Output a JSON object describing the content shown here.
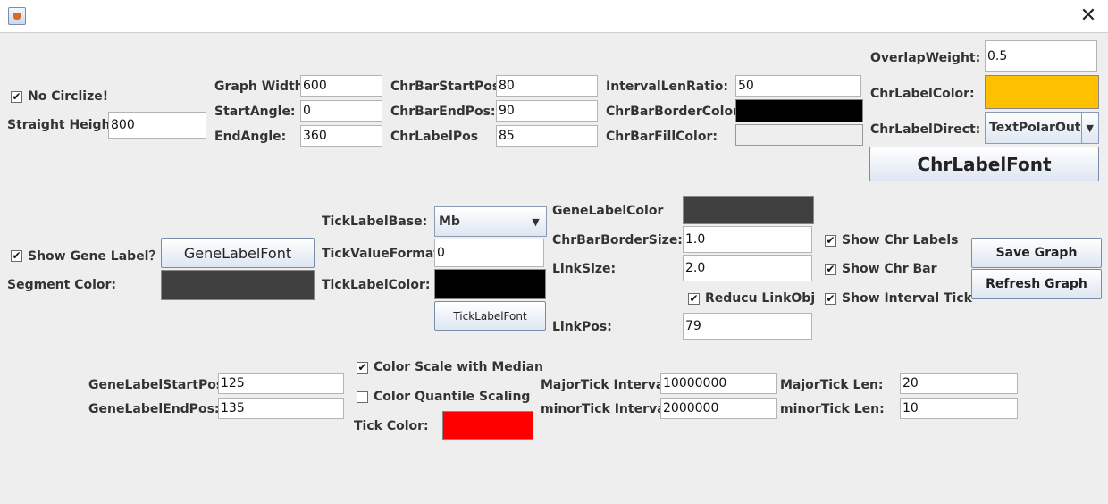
{
  "window": {
    "close_glyph": "✕",
    "app_icon": "java-cup-icon"
  },
  "col1": {
    "no_circlize": {
      "label": "No Circlize!",
      "checked": true
    },
    "straight_height": {
      "label": "Straight Height:",
      "value": "800"
    }
  },
  "col2": {
    "graph_width": {
      "label": "Graph Width:",
      "value": "600"
    },
    "start_angle": {
      "label": "StartAngle:",
      "value": "0"
    },
    "end_angle": {
      "label": "EndAngle:",
      "value": "360"
    }
  },
  "col3": {
    "chr_bar_start_pos": {
      "label": "ChrBarStartPos:",
      "value": "80"
    },
    "chr_bar_end_pos": {
      "label": "ChrBarEndPos:",
      "value": "90"
    },
    "chr_label_pos": {
      "label": "ChrLabelPos",
      "value": "85"
    }
  },
  "col4": {
    "interval_len_ratio": {
      "label": "IntervalLenRatio:",
      "value": "50"
    },
    "chr_bar_border_color": {
      "label": "ChrBarBorderColor:",
      "color": "#000000"
    },
    "chr_bar_fill_color": {
      "label": "ChrBarFillColor:",
      "color": "#eeeeee"
    }
  },
  "col5": {
    "overlap_weight": {
      "label": "OverlapWeight:",
      "value": "0.5"
    },
    "chr_label_color": {
      "label": "ChrLabelColor:",
      "color": "#ffc000"
    },
    "chr_label_direct": {
      "label": "ChrLabelDirect:",
      "value": "TextPolarOut"
    },
    "chr_label_font_button": "ChrLabelFont"
  },
  "gene": {
    "show_gene_label": {
      "label": "Show Gene Label？",
      "checked": true
    },
    "gene_label_font_button": "GeneLabelFont",
    "segment_color": {
      "label": "Segment Color:",
      "color": "#404040"
    }
  },
  "tick": {
    "tick_label_base": {
      "label": "TickLabelBase:",
      "value": "Mb"
    },
    "tick_value_format": {
      "label": "TickValueFormat:",
      "value": "0"
    },
    "tick_label_color": {
      "label": "TickLabelColor:",
      "color": "#000000"
    },
    "tick_label_font_button": "TickLabelFont"
  },
  "link": {
    "gene_label_color": {
      "label": "GeneLabelColor",
      "color": "#404040"
    },
    "chr_bar_border_size": {
      "label": "ChrBarBorderSize:",
      "value": "1.0"
    },
    "link_size": {
      "label": "LinkSize:",
      "value": "2.0"
    },
    "reducu_link_obj": {
      "label": "Reducu LinkObj",
      "checked": true
    },
    "link_pos": {
      "label": "LinkPos:",
      "value": "79"
    }
  },
  "show": {
    "show_chr_labels": {
      "label": "Show Chr Labels",
      "checked": true
    },
    "show_chr_bar": {
      "label": "Show Chr Bar",
      "checked": true
    },
    "show_interval_tick": {
      "label": "Show Interval Tick",
      "checked": true
    }
  },
  "actions": {
    "save_graph": "Save Graph",
    "refresh_graph": "Refresh Graph"
  },
  "bottom": {
    "gene_label_start_pos": {
      "label": "GeneLabelStartPos:",
      "value": "125"
    },
    "gene_label_end_pos": {
      "label": "GeneLabelEndPos:",
      "value": "135"
    },
    "color_scale_median": {
      "label": "Color Scale with Median",
      "checked": true
    },
    "color_quantile_scaling": {
      "label": "Color Quantile Scaling",
      "checked": false
    },
    "tick_color": {
      "label": "Tick Color:",
      "color": "#ff0000"
    },
    "major_tick_interval": {
      "label": "MajorTick Interval:",
      "value": "10000000"
    },
    "minor_tick_interval": {
      "label": "minorTick Interval:",
      "value": "2000000"
    },
    "major_tick_len": {
      "label": "MajorTick Len:",
      "value": "20"
    },
    "minor_tick_len": {
      "label": "minorTick Len:",
      "value": "10"
    }
  },
  "glyphs": {
    "check": "✔",
    "arrow": "▼"
  }
}
